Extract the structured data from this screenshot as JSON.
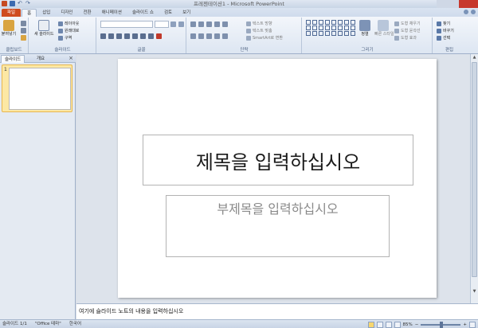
{
  "window": {
    "title": "프레젠테이션1 - Microsoft PowerPoint"
  },
  "tabs": [
    "파일",
    "홈",
    "삽입",
    "디자인",
    "전환",
    "애니메이션",
    "슬라이드 쇼",
    "검토",
    "보기"
  ],
  "ribbon": {
    "clipboard": {
      "label": "클립보드",
      "paste": "붙여넣기"
    },
    "slides": {
      "label": "슬라이드",
      "new_slide": "새 슬라이드",
      "layout": "레이아웃",
      "reset": "원래대로",
      "section": "구역"
    },
    "font": {
      "label": "글꼴"
    },
    "paragraph": {
      "label": "단락",
      "text_direction": "텍스트 방향",
      "align_text": "텍스트 맞춤",
      "smartart": "SmartArt로 변환"
    },
    "drawing": {
      "label": "그리기",
      "arrange": "정렬",
      "quick_styles": "빠른 스타일",
      "shape_fill": "도형 채우기",
      "shape_outline": "도형 윤곽선",
      "shape_effects": "도형 효과"
    },
    "editing": {
      "label": "편집",
      "find": "찾기",
      "replace": "바꾸기",
      "select": "선택"
    }
  },
  "left_pane": {
    "tabs": [
      "슬라이드",
      "개요"
    ],
    "close": "×",
    "thumbnail_number": "1"
  },
  "slide": {
    "title_placeholder": "제목을 입력하십시오",
    "subtitle_placeholder": "부제목을 입력하십시오"
  },
  "notes": {
    "placeholder": "여기에 슬라이드 노트의 내용을 입력하십시오"
  },
  "status": {
    "slide_count": "슬라이드 1/1",
    "theme": "\"Office 테마\"",
    "language": "한국어",
    "zoom": "85%",
    "zoom_minus": "−",
    "zoom_plus": "+"
  },
  "colors": {
    "file_tab": "#cf4c1f",
    "selection": "#fce8a4",
    "ribbon_bg": "#f3f6fb"
  }
}
